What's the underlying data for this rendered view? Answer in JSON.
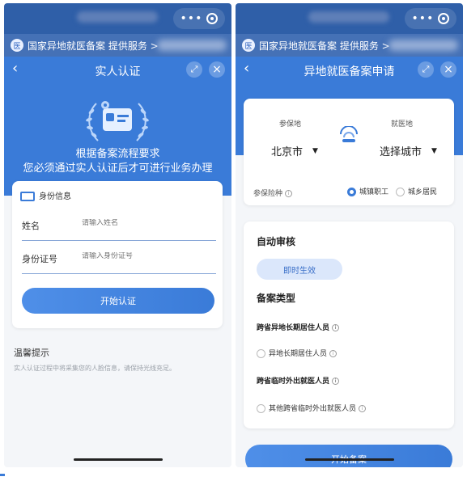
{
  "left": {
    "mp_label": "国家异地就医备案 提供服务 >",
    "nav_title": "实人认证",
    "hero_line1": "根据备案流程要求",
    "hero_line2": "您必须通过实人认证后才可进行业务办理",
    "section_title": "身份信息",
    "name_label": "姓名",
    "name_placeholder": "请输入姓名",
    "id_label": "身份证号",
    "id_placeholder": "请输入身份证号",
    "start_button": "开始认证",
    "tip_title": "温馨提示",
    "tip_text": "实人认证过程中将采集您的人脸信息，请保持光线充足。"
  },
  "right": {
    "mp_label": "国家异地就医备案 提供服务 >",
    "nav_title": "异地就医备案申请",
    "insured_place_label": "参保地",
    "insured_place_value": "北京市",
    "medical_place_label": "就医地",
    "medical_place_value": "选择城市",
    "insurance_type_label": "参保险种",
    "option_employee": "城镇职工",
    "option_resident": "城乡居民",
    "selected_option": "城镇职工",
    "auto_review_title": "自动审核",
    "effective_pill": "即时生效",
    "record_type_title": "备案类型",
    "group1_title": "跨省异地长期居住人员",
    "group1_option": "异地长期居住人员",
    "group2_title": "跨省临时外出就医人员",
    "group2_option": "其他跨省临时外出就医人员",
    "bottom_button": "开始备案"
  },
  "colors": {
    "brand_blue": "#3a7bd8",
    "top_bar": "#2f5fa8",
    "mp_bar": "#4571b6",
    "page_bg": "#f4f6f9"
  },
  "icons": [
    "dots-icon",
    "target-icon",
    "mp-logo-icon",
    "back-icon",
    "expand-icon",
    "close-icon",
    "laurel-badge-icon",
    "id-card-icon",
    "transfer-icon",
    "info-icon",
    "radio-icon",
    "caret-down-icon"
  ]
}
